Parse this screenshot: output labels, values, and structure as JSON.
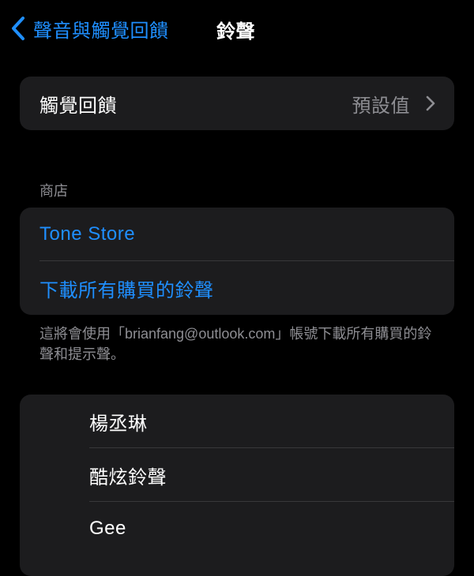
{
  "nav": {
    "back_label": "聲音與觸覺回饋",
    "title": "鈴聲"
  },
  "haptics": {
    "label": "觸覺回饋",
    "value": "預設值"
  },
  "store": {
    "header": "商店",
    "tone_store": "Tone Store",
    "download_all": "下載所有購買的鈴聲",
    "footer": "這將會使用「brianfang@outlook.com」帳號下載所有購買的鈴聲和提示聲。"
  },
  "ringtones": [
    {
      "name": "楊丞琳"
    },
    {
      "name": "酷炫鈴聲"
    },
    {
      "name": "Gee"
    }
  ],
  "colors": {
    "accent": "#1f8fff",
    "background": "#000000",
    "cell": "#1c1c1e",
    "secondary_text": "#8e8e93",
    "separator": "#38383a"
  }
}
